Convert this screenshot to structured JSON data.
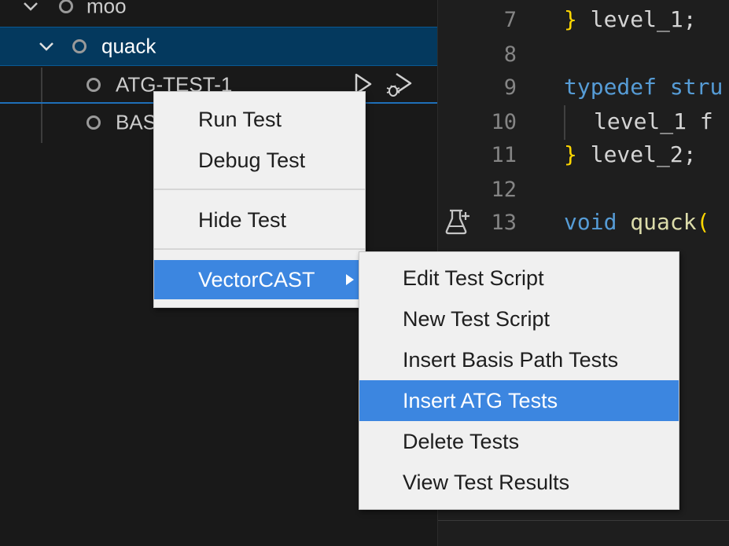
{
  "tree": {
    "items": [
      {
        "label": "moo"
      },
      {
        "label": "quack"
      },
      {
        "label": "ATG-TEST-1"
      },
      {
        "label": "BASIS"
      }
    ]
  },
  "editor": {
    "lines": [
      {
        "num": "7",
        "text": "} level_1;"
      },
      {
        "num": "8",
        "text": ""
      },
      {
        "num": "9",
        "kw": "typedef",
        "rest": " stru"
      },
      {
        "num": "10",
        "text": "level_1 f"
      },
      {
        "num": "11",
        "text": "} level_2;"
      },
      {
        "num": "12",
        "text": ""
      },
      {
        "num": "13",
        "kw": "void",
        "fn": " quack",
        "paren": "("
      }
    ]
  },
  "context_menu": {
    "items": [
      "Run Test",
      "Debug Test",
      "Hide Test",
      "VectorCAST"
    ]
  },
  "submenu": {
    "items": [
      "Edit Test Script",
      "New Test Script",
      "Insert Basis Path Tests",
      "Insert ATG Tests",
      "Delete Tests",
      "View Test Results"
    ],
    "selected": "Insert ATG Tests"
  },
  "colors": {
    "selection_blue": "#3c86e0",
    "tree_selected_bg": "#04395e",
    "keyword": "#569cd6",
    "bracket": "#ffd700"
  },
  "icons": [
    "chevron-down-icon",
    "circle-icon",
    "run-test-icon",
    "debug-test-icon",
    "beaker-add-icon",
    "submenu-arrow-icon"
  ]
}
